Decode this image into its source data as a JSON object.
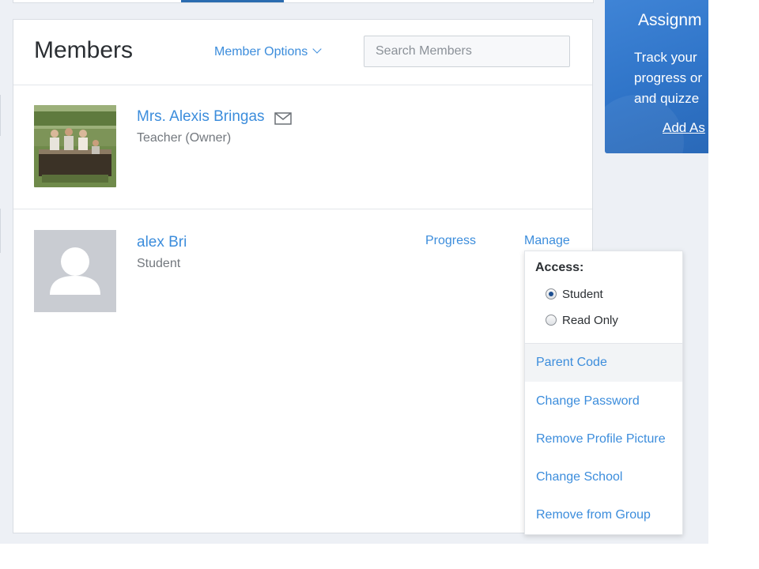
{
  "header": {
    "title": "Members",
    "member_options_label": "Member Options",
    "search_placeholder": "Search Members"
  },
  "members": [
    {
      "name": "Mrs. Alexis Bringas",
      "role": "Teacher (Owner)"
    },
    {
      "name": "alex Bri",
      "role": "Student",
      "progress_label": "Progress",
      "manage_label": "Manage"
    }
  ],
  "manage_menu": {
    "access_label": "Access:",
    "access_options": [
      {
        "label": "Student",
        "selected": true
      },
      {
        "label": "Read Only",
        "selected": false
      }
    ],
    "items": [
      "Parent Code",
      "Change Password",
      "Remove Profile Picture",
      "Change School",
      "Remove from Group"
    ]
  },
  "promo": {
    "title": "Assignm",
    "body": "Track your\nprogress or\nand quizze",
    "link": "Add As"
  },
  "colors": {
    "link": "#3c8ddc",
    "promo_bg": "#2f74c8",
    "page_bg": "#edf0f5"
  }
}
